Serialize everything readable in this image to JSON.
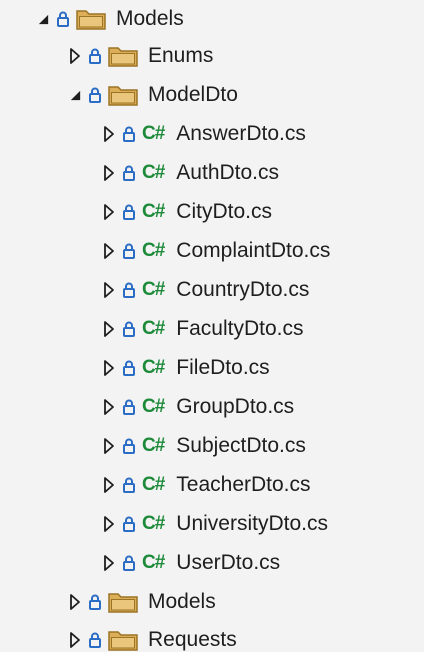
{
  "tree": {
    "root": {
      "label": "Models"
    },
    "enums": {
      "label": "Enums"
    },
    "modeldto": {
      "label": "ModelDto"
    },
    "files": [
      {
        "label": "AnswerDto.cs",
        "badge": "C#"
      },
      {
        "label": "AuthDto.cs",
        "badge": "C#"
      },
      {
        "label": "CityDto.cs",
        "badge": "C#"
      },
      {
        "label": "ComplaintDto.cs",
        "badge": "C#"
      },
      {
        "label": "CountryDto.cs",
        "badge": "C#"
      },
      {
        "label": "FacultyDto.cs",
        "badge": "C#"
      },
      {
        "label": "FileDto.cs",
        "badge": "C#"
      },
      {
        "label": "GroupDto.cs",
        "badge": "C#"
      },
      {
        "label": "SubjectDto.cs",
        "badge": "C#"
      },
      {
        "label": "TeacherDto.cs",
        "badge": "C#"
      },
      {
        "label": "UniversityDto.cs",
        "badge": "C#"
      },
      {
        "label": "UserDto.cs",
        "badge": "C#"
      }
    ],
    "models": {
      "label": "Models"
    },
    "requests": {
      "label": "Requests"
    }
  },
  "colors": {
    "cs_badge": "#1d8a3a",
    "lock": "#2b6cc4",
    "folder": "#d8a84c",
    "folder_dark": "#b68a2e"
  },
  "icons": {
    "expanded": "expanded-triangle-icon",
    "collapsed": "collapsed-triangle-icon",
    "lock": "lock-icon",
    "folder": "folder-icon"
  }
}
